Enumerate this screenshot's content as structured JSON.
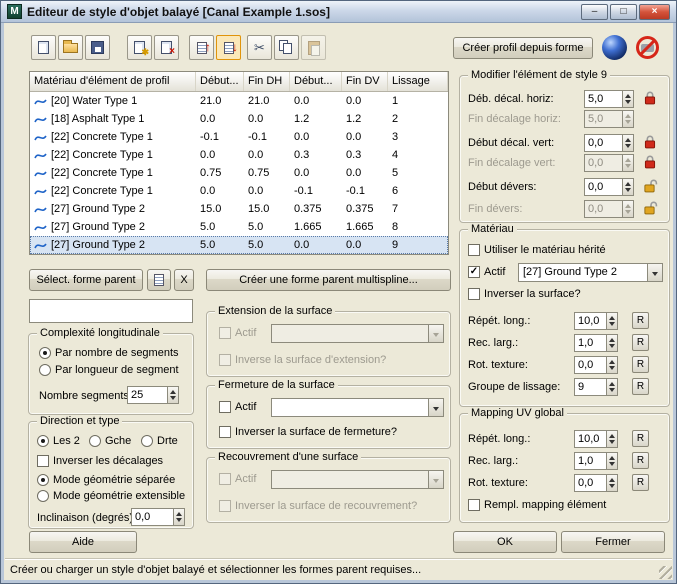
{
  "window": {
    "app_icon": "M",
    "title": "Editeur de style d'objet balayé [Canal Example 1.sos]",
    "controls": {
      "minimize": "–",
      "maximize": "□",
      "close": "×"
    },
    "status": "Créer ou charger un style d'objet balayé et sélectionner les formes parent requises..."
  },
  "toolbar": {
    "create_profile_from_shape": "Créer profil depuis forme",
    "icons": [
      "new-style",
      "open-style",
      "save-style",
      "new-element",
      "delete-element",
      "move-element-up",
      "move-element-down",
      "cut",
      "copy",
      "paste",
      "material-sphere",
      "disable-sign"
    ]
  },
  "profile_table": {
    "headers": [
      "Matériau d'élément de profil",
      "Début...",
      "Fin DH",
      "Début...",
      "Fin DV",
      "Lissage"
    ],
    "selected_row": 9,
    "rows": [
      {
        "material": "[20] Water Type 1",
        "deb_dh": "21.0",
        "fin_dh": "21.0",
        "deb_dv": "0.0",
        "fin_dv": "0.0",
        "lissage": "1"
      },
      {
        "material": "[18] Asphalt Type 1",
        "deb_dh": "0.0",
        "fin_dh": "0.0",
        "deb_dv": "1.2",
        "fin_dv": "1.2",
        "lissage": "2"
      },
      {
        "material": "[22] Concrete Type 1",
        "deb_dh": "-0.1",
        "fin_dh": "-0.1",
        "deb_dv": "0.0",
        "fin_dv": "0.0",
        "lissage": "3"
      },
      {
        "material": "[22] Concrete Type 1",
        "deb_dh": "0.0",
        "fin_dh": "0.0",
        "deb_dv": "0.3",
        "fin_dv": "0.3",
        "lissage": "4"
      },
      {
        "material": "[22] Concrete Type 1",
        "deb_dh": "0.75",
        "fin_dh": "0.75",
        "deb_dv": "0.0",
        "fin_dv": "0.0",
        "lissage": "5"
      },
      {
        "material": "[22] Concrete Type 1",
        "deb_dh": "0.0",
        "fin_dh": "0.0",
        "deb_dv": "-0.1",
        "fin_dv": "-0.1",
        "lissage": "6"
      },
      {
        "material": "[27] Ground Type 2",
        "deb_dh": "15.0",
        "fin_dh": "15.0",
        "deb_dv": "0.375",
        "fin_dv": "0.375",
        "lissage": "7"
      },
      {
        "material": "[27] Ground Type 2",
        "deb_dh": "5.0",
        "fin_dh": "5.0",
        "deb_dv": "1.665",
        "fin_dv": "1.665",
        "lissage": "8"
      },
      {
        "material": "[27] Ground Type 2",
        "deb_dh": "5.0",
        "fin_dh": "5.0",
        "deb_dv": "0.0",
        "fin_dv": "0.0",
        "lissage": "9"
      }
    ]
  },
  "parent_shape": {
    "select_button": "Sélect. forme parent",
    "clear_button": "X",
    "name_value": "",
    "create_multispline_button": "Créer une forme parent multispline..."
  },
  "complexity": {
    "title": "Complexité longitudinale",
    "by_count": "Par nombre de segments",
    "by_length": "Par longueur de segment",
    "segments_label": "Nombre segments:",
    "segments_value": "25"
  },
  "direction": {
    "title": "Direction et type",
    "both": "Les 2",
    "left": "Gche",
    "right": "Drte",
    "invert_offsets": "Inverser les décalages",
    "separate_mode": "Mode géométrie séparée",
    "extensible_mode": "Mode géométrie extensible",
    "inclination_label": "Inclinaison (degrés):",
    "inclination_value": "0,0"
  },
  "surface_extension": {
    "title": "Extension de la surface",
    "active": "Actif",
    "invert": "Inverse la surface d'extension?"
  },
  "surface_closure": {
    "title": "Fermeture de la surface",
    "active": "Actif",
    "invert": "Inverser la surface de fermeture?"
  },
  "surface_overlay": {
    "title": "Recouvrement d'une surface",
    "active": "Actif",
    "invert": "Inverser la surface de recouvrement?"
  },
  "style_element": {
    "title": "Modifier l'élément de style 9",
    "rows": [
      {
        "label": "Déb. décal. horiz:",
        "value": "5,0"
      },
      {
        "label": "Fin décalage horiz:",
        "value": "5,0"
      },
      {
        "label": "Début décal. vert:",
        "value": "0,0"
      },
      {
        "label": "Fin décalage vert:",
        "value": "0,0"
      },
      {
        "label": "Début dévers:",
        "value": "0,0"
      },
      {
        "label": "Fin dévers:",
        "value": "0,0"
      }
    ]
  },
  "material": {
    "title": "Matériau",
    "use_inherited": "Utiliser le matériau hérité",
    "active": "Actif",
    "active_value": "[27] Ground Type 2",
    "invert_surface": "Inverser la surface?",
    "repeat_label": "Répét. long.:",
    "repeat_value": "10,0",
    "width_label": "Rec. larg.:",
    "width_value": "1,0",
    "rotation_label": "Rot. texture:",
    "rotation_value": "0,0",
    "smoothing_label": "Groupe de lissage:",
    "smoothing_value": "9"
  },
  "uv_mapping": {
    "title": "Mapping UV global",
    "repeat_label": "Répét. long.:",
    "repeat_value": "10,0",
    "width_label": "Rec. larg.:",
    "width_value": "1,0",
    "rotation_label": "Rot. texture:",
    "rotation_value": "0,0",
    "replace_mapping": "Rempl. mapping élément"
  },
  "labels": {
    "reset": "R"
  },
  "footer": {
    "help": "Aide",
    "ok": "OK",
    "close": "Fermer"
  },
  "colors": {
    "selection": "#d7e4f3",
    "lock_closed": "#cf2a1b",
    "lock_open": "#e0a520",
    "dialog_bg": "#ece9d8"
  }
}
